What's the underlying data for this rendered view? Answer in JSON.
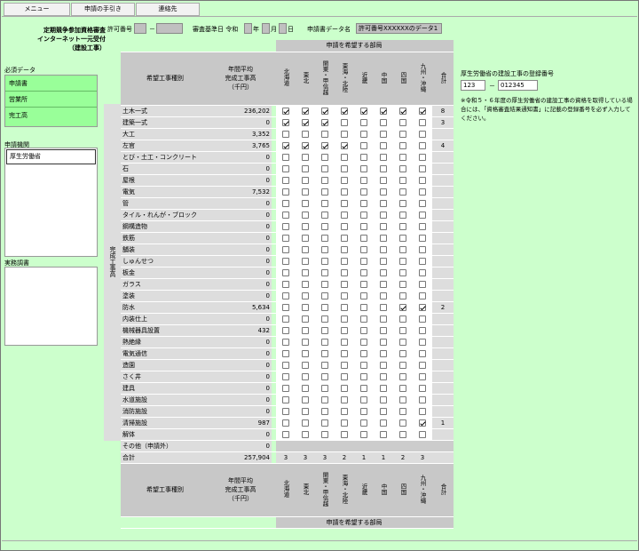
{
  "menu": {
    "items": [
      "メニュー",
      "申請の手引き",
      "連絡先"
    ]
  },
  "header": {
    "title_lines": [
      "定期競争参加資格審査",
      "インターネット一元受付",
      "（建設工事）"
    ],
    "permit_label": "許可番号",
    "permit_dash": "－",
    "base_date_label": "審査基準日 令和",
    "year_label": "年",
    "month_label": "月",
    "day_label": "日",
    "data_name_label": "申請書データ名",
    "data_name_value": "許可番号XXXXXXのデータ1"
  },
  "left": {
    "required_label": "必須データ",
    "required_items": [
      "申請書",
      "営業所",
      "完工高"
    ],
    "agency_label": "申請機関",
    "agency_items": [
      "厚生労働省"
    ],
    "practice_label": "実務調書"
  },
  "table": {
    "dept_header": "申請を希望する部局",
    "type_header": "希望工事種別",
    "avg_header": [
      "年間平均",
      "完成工事高",
      "（千円）"
    ],
    "side_label": "完成工事高",
    "regions": [
      "北海道",
      "東北",
      "関東・甲信越",
      "東海・北陸",
      "近畿",
      "中国",
      "四国",
      "九州・沖縄"
    ],
    "total_header": "合計",
    "rows": [
      {
        "name": "土木一式",
        "value": "236,202",
        "checks": [
          1,
          1,
          1,
          1,
          1,
          1,
          1,
          1
        ],
        "total": "8"
      },
      {
        "name": "建築一式",
        "value": "0",
        "checks": [
          1,
          1,
          1,
          0,
          0,
          0,
          0,
          0
        ],
        "total": "3"
      },
      {
        "name": "大工",
        "value": "3,352",
        "checks": [
          0,
          0,
          0,
          0,
          0,
          0,
          0,
          0
        ],
        "total": ""
      },
      {
        "name": "左官",
        "value": "3,765",
        "checks": [
          1,
          1,
          1,
          1,
          0,
          0,
          0,
          0
        ],
        "total": "4"
      },
      {
        "name": "とび・土工・コンクリート",
        "value": "0",
        "checks": [
          0,
          0,
          0,
          0,
          0,
          0,
          0,
          0
        ],
        "total": ""
      },
      {
        "name": "石",
        "value": "0",
        "checks": [
          0,
          0,
          0,
          0,
          0,
          0,
          0,
          0
        ],
        "total": ""
      },
      {
        "name": "屋根",
        "value": "0",
        "checks": [
          0,
          0,
          0,
          0,
          0,
          0,
          0,
          0
        ],
        "total": ""
      },
      {
        "name": "電気",
        "value": "7,532",
        "checks": [
          0,
          0,
          0,
          0,
          0,
          0,
          0,
          0
        ],
        "total": ""
      },
      {
        "name": "管",
        "value": "0",
        "checks": [
          0,
          0,
          0,
          0,
          0,
          0,
          0,
          0
        ],
        "total": ""
      },
      {
        "name": "タイル・れんが・ブロック",
        "value": "0",
        "checks": [
          0,
          0,
          0,
          0,
          0,
          0,
          0,
          0
        ],
        "total": ""
      },
      {
        "name": "鋼構造物",
        "value": "0",
        "checks": [
          0,
          0,
          0,
          0,
          0,
          0,
          0,
          0
        ],
        "total": ""
      },
      {
        "name": "鉄筋",
        "value": "0",
        "checks": [
          0,
          0,
          0,
          0,
          0,
          0,
          0,
          0
        ],
        "total": ""
      },
      {
        "name": "舗装",
        "value": "0",
        "checks": [
          0,
          0,
          0,
          0,
          0,
          0,
          0,
          0
        ],
        "total": ""
      },
      {
        "name": "しゅんせつ",
        "value": "0",
        "checks": [
          0,
          0,
          0,
          0,
          0,
          0,
          0,
          0
        ],
        "total": ""
      },
      {
        "name": "板金",
        "value": "0",
        "checks": [
          0,
          0,
          0,
          0,
          0,
          0,
          0,
          0
        ],
        "total": ""
      },
      {
        "name": "ガラス",
        "value": "0",
        "checks": [
          0,
          0,
          0,
          0,
          0,
          0,
          0,
          0
        ],
        "total": ""
      },
      {
        "name": "塗装",
        "value": "0",
        "checks": [
          0,
          0,
          0,
          0,
          0,
          0,
          0,
          0
        ],
        "total": ""
      },
      {
        "name": "防水",
        "value": "5,634",
        "checks": [
          0,
          0,
          0,
          0,
          0,
          0,
          1,
          1
        ],
        "total": "2"
      },
      {
        "name": "内装仕上",
        "value": "0",
        "checks": [
          0,
          0,
          0,
          0,
          0,
          0,
          0,
          0
        ],
        "total": ""
      },
      {
        "name": "機械器具設置",
        "value": "432",
        "checks": [
          0,
          0,
          0,
          0,
          0,
          0,
          0,
          0
        ],
        "total": ""
      },
      {
        "name": "熱絶縁",
        "value": "0",
        "checks": [
          0,
          0,
          0,
          0,
          0,
          0,
          0,
          0
        ],
        "total": ""
      },
      {
        "name": "電気通信",
        "value": "0",
        "checks": [
          0,
          0,
          0,
          0,
          0,
          0,
          0,
          0
        ],
        "total": ""
      },
      {
        "name": "造園",
        "value": "0",
        "checks": [
          0,
          0,
          0,
          0,
          0,
          0,
          0,
          0
        ],
        "total": ""
      },
      {
        "name": "さく井",
        "value": "0",
        "checks": [
          0,
          0,
          0,
          0,
          0,
          0,
          0,
          0
        ],
        "total": ""
      },
      {
        "name": "建具",
        "value": "0",
        "checks": [
          0,
          0,
          0,
          0,
          0,
          0,
          0,
          0
        ],
        "total": ""
      },
      {
        "name": "水道施設",
        "value": "0",
        "checks": [
          0,
          0,
          0,
          0,
          0,
          0,
          0,
          0
        ],
        "total": ""
      },
      {
        "name": "消防施設",
        "value": "0",
        "checks": [
          0,
          0,
          0,
          0,
          0,
          0,
          0,
          0
        ],
        "total": ""
      },
      {
        "name": "清掃施設",
        "value": "987",
        "checks": [
          0,
          0,
          0,
          0,
          0,
          0,
          0,
          1
        ],
        "total": "1"
      },
      {
        "name": "解体",
        "value": "0",
        "checks": [
          0,
          0,
          0,
          0,
          0,
          0,
          0,
          0
        ],
        "total": ""
      }
    ],
    "other_row": {
      "name": "その他（申請外）",
      "value": "0"
    },
    "total_row": {
      "name": "合計",
      "value": "257,904",
      "counts": [
        "3",
        "3",
        "3",
        "2",
        "1",
        "1",
        "2",
        "3"
      ]
    }
  },
  "right": {
    "label": "厚生労働省の建設工事の登録番号",
    "num1": "123",
    "dash": "－",
    "num2": "012345",
    "note": "※令和５・６年度の厚生労働省の建設工事の資格を取得している場合には、「資格審査結果通知書」に記載の登録番号を必ず入力してください。"
  }
}
